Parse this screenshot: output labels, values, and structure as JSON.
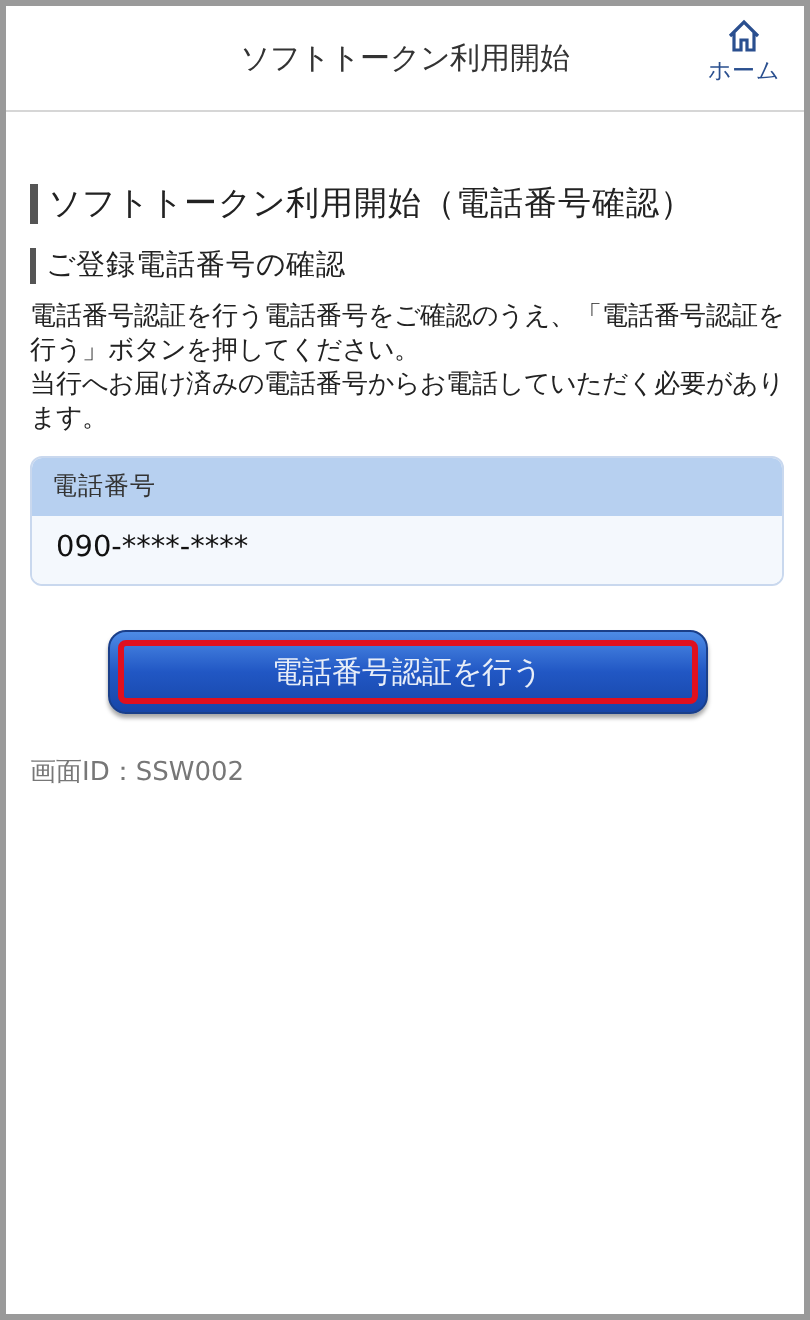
{
  "header": {
    "title": "ソフトトークン利用開始",
    "home_label": "ホーム"
  },
  "page_title": "ソフトトークン利用開始（電話番号確認）",
  "section_title": "ご登録電話番号の確認",
  "paragraphs": [
    "電話番号認証を行う電話番号をご確認のうえ、「電話番号認証を行う」ボタンを押してください。",
    "当行へお届け済みの電話番号からお電話していただく必要があります。"
  ],
  "phone_panel": {
    "label": "電話番号",
    "value": "090-****-****"
  },
  "button": {
    "label": "電話番号認証を行う",
    "highlighted": true
  },
  "screen_id": "画面ID：SSW002"
}
